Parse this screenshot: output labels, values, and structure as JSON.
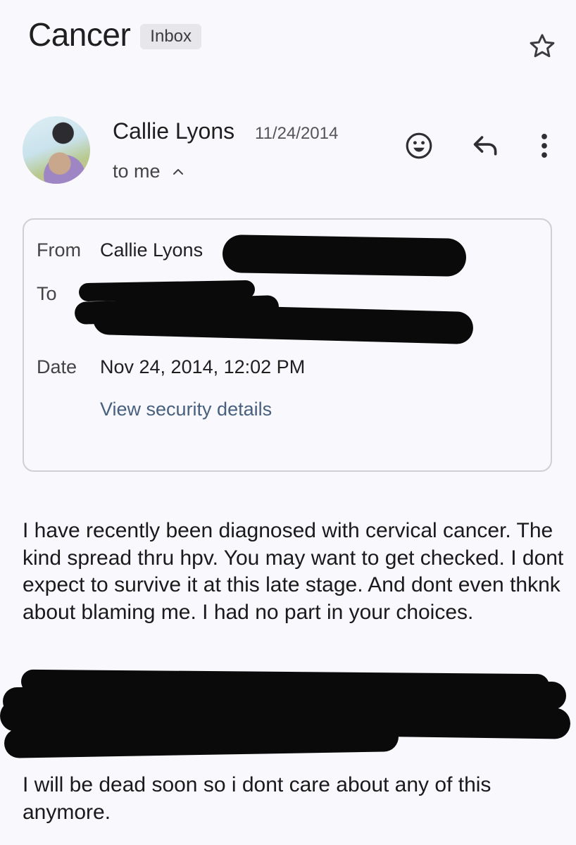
{
  "subject": "Cancer",
  "label": "Inbox",
  "sender": {
    "name": "Callie Lyons",
    "date": "11/24/2014",
    "to": "to me"
  },
  "details": {
    "from_label": "From",
    "from_value": "Callie Lyons",
    "to_label": "To",
    "date_label": "Date",
    "date_value": "Nov 24, 2014, 12:02 PM",
    "security_link": "View security details"
  },
  "body": {
    "paragraph1": "I have recently been diagnosed with cervical cancer. The kind spread thru hpv. You may want to get checked.  I dont expect to survive it at this late stage.   And dont even thknk about blaming me. I had no part in your choices.",
    "paragraph2": "I will be dead soon so i dont care about any of this anymore."
  },
  "icons": {
    "star": "star-outline-icon",
    "reaction": "add-reaction-icon",
    "reply": "reply-icon",
    "more": "more-vert-icon",
    "chevron": "chevron-up-icon"
  }
}
